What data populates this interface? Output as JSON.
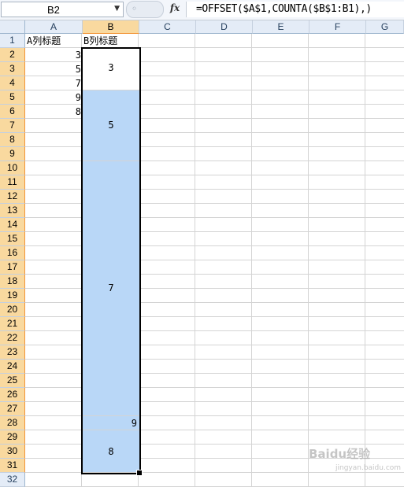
{
  "formula_bar": {
    "name_box": "B2",
    "name_box_dropdown": "▼",
    "fx_label": "fx",
    "formula": "=OFFSET($A$1,COUNTA($B$1:B1),)"
  },
  "columns": [
    "A",
    "B",
    "C",
    "D",
    "E",
    "F",
    "G"
  ],
  "selected_column": "B",
  "rows": [
    "1",
    "2",
    "3",
    "4",
    "5",
    "6",
    "7",
    "8",
    "9",
    "10",
    "11",
    "12",
    "13",
    "14",
    "15",
    "16",
    "17",
    "18",
    "19",
    "20",
    "21",
    "22",
    "23",
    "24",
    "25",
    "26",
    "27",
    "28",
    "29",
    "30",
    "31",
    "32"
  ],
  "cells": {
    "A1": "A列标题",
    "B1": "B列标题",
    "A2": "3",
    "A3": "5",
    "A4": "7",
    "A5": "9",
    "A6": "8"
  },
  "merged_b": [
    {
      "rows": "2-4",
      "value": "3"
    },
    {
      "rows": "5-9",
      "value": "5"
    },
    {
      "rows": "10-27",
      "value": "7"
    },
    {
      "rows": "28",
      "value": "9"
    },
    {
      "rows": "29-31",
      "value": "8"
    }
  ],
  "watermark": {
    "text": "Baidu经验",
    "sub": "jingyan.baidu.com"
  },
  "colors": {
    "selection_fill": "#b9d7f7",
    "header_selected": "#f9d99f",
    "header": "#e4ecf7"
  }
}
